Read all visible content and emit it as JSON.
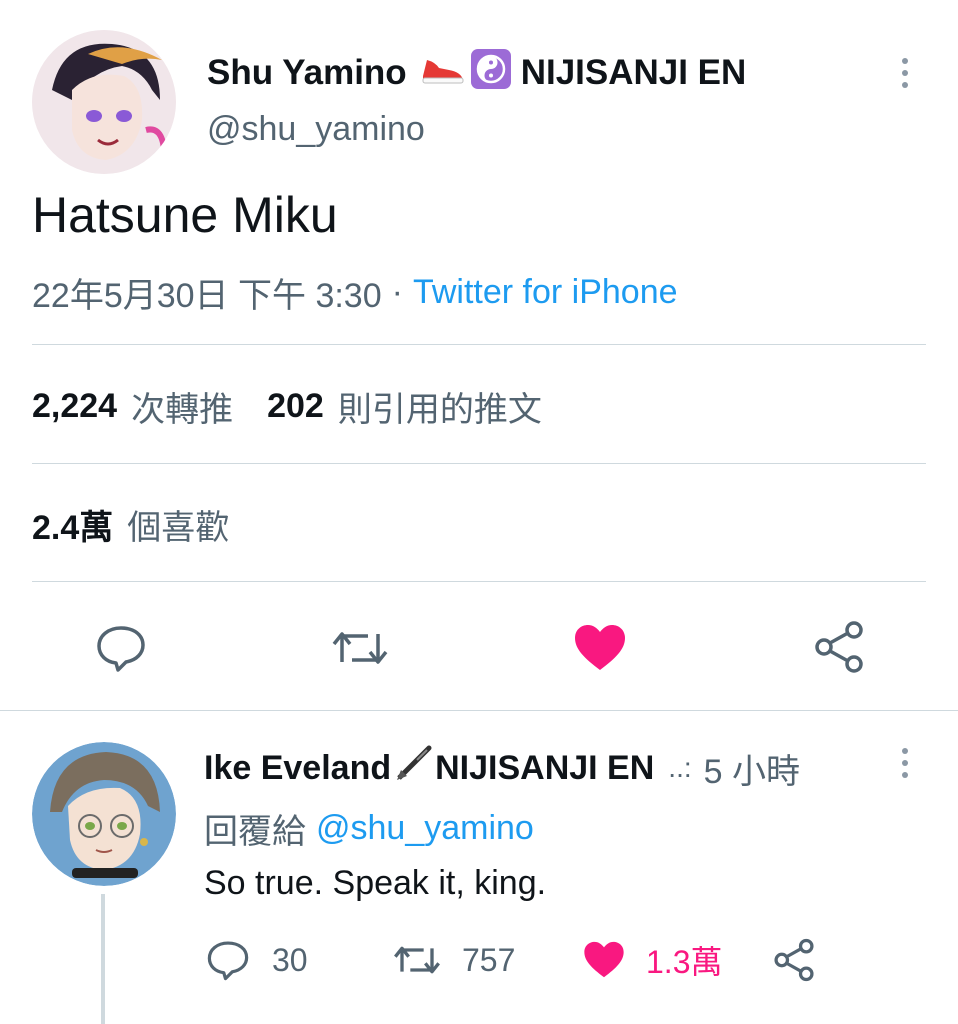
{
  "tweet": {
    "author_name": "Shu Yamino",
    "author_suffix": "NIJISANJI EN",
    "handle": "@shu_yamino",
    "text": "Hatsune Miku",
    "timestamp": "22年5月30日 下午 3:30",
    "separator": "·",
    "source": "Twitter for iPhone",
    "retweets_count": "2,224",
    "retweets_label": "次轉推",
    "quotes_count": "202",
    "quotes_label": "則引用的推文",
    "likes_count": "2.4萬",
    "likes_label": "個喜歡"
  },
  "reply": {
    "author_name": "Ike Eveland",
    "author_suffix": "NIJISANJI EN",
    "ellipsis": "..:",
    "time": "5 小時",
    "replying_prefix": "回覆給",
    "replying_to": "@shu_yamino",
    "text": "So true. Speak it, king.",
    "reply_count": "30",
    "retweet_count": "757",
    "like_count": "1.3萬"
  },
  "colors": {
    "like_pink": "#f91880",
    "link_blue": "#1d9bf0",
    "muted_gray": "#536471",
    "icon_gray": "#536471"
  },
  "icons": [
    "more-icon",
    "reply-icon",
    "retweet-icon",
    "heart-icon",
    "share-icon",
    "sneaker-emoji",
    "yin-yang-emoji",
    "fountain-pen-emoji"
  ]
}
